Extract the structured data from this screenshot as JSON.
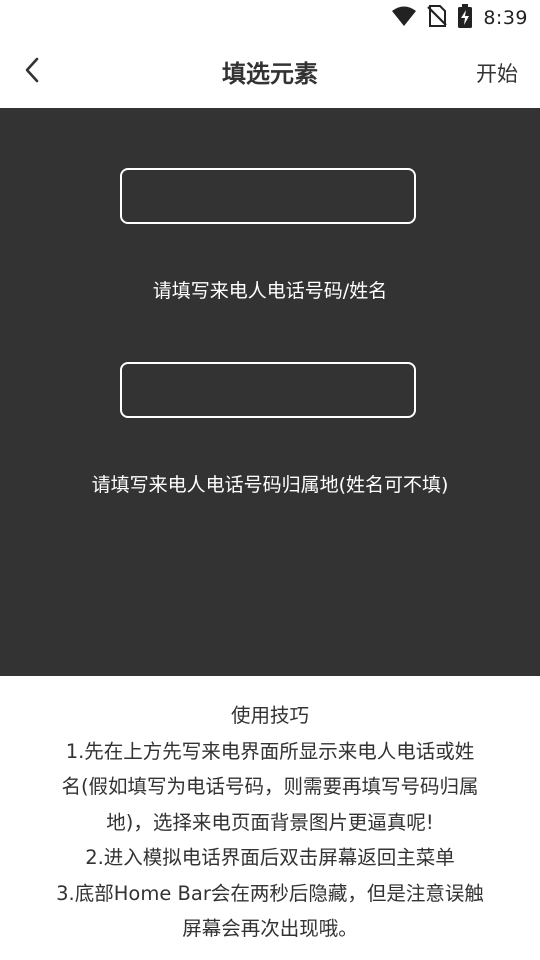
{
  "status_bar": {
    "time": "8:39",
    "icons": [
      "wifi-icon",
      "no-sim-icon",
      "battery-charging-icon"
    ]
  },
  "header": {
    "back_icon": "chevron-left-icon",
    "title": "填选元素",
    "start_label": "开始"
  },
  "form": {
    "number_field": {
      "value": "",
      "placeholder": ""
    },
    "number_label": "请填写来电人电话号码/姓名",
    "location_field": {
      "value": "",
      "placeholder": ""
    },
    "location_label": "请填写来电人电话号码归属地(姓名可不填)"
  },
  "tips": {
    "lines": [
      "使用技巧",
      "1.先在上方先写来电界面所显示来电人电话或姓",
      "名(假如填写为电话号码，则需要再填写号码归属",
      "地)，选择来电页面背景图片更逼真呢!",
      "2.进入模拟电话界面后双击屏幕返回主菜单",
      "3.底部Home Bar会在两秒后隐藏，但是注意误触",
      "屏幕会再次出现哦。"
    ]
  },
  "colors": {
    "panel_background": "#333333",
    "page_background": "#ffffff",
    "text_dark": "#333333",
    "text_light": "#ffffff"
  }
}
